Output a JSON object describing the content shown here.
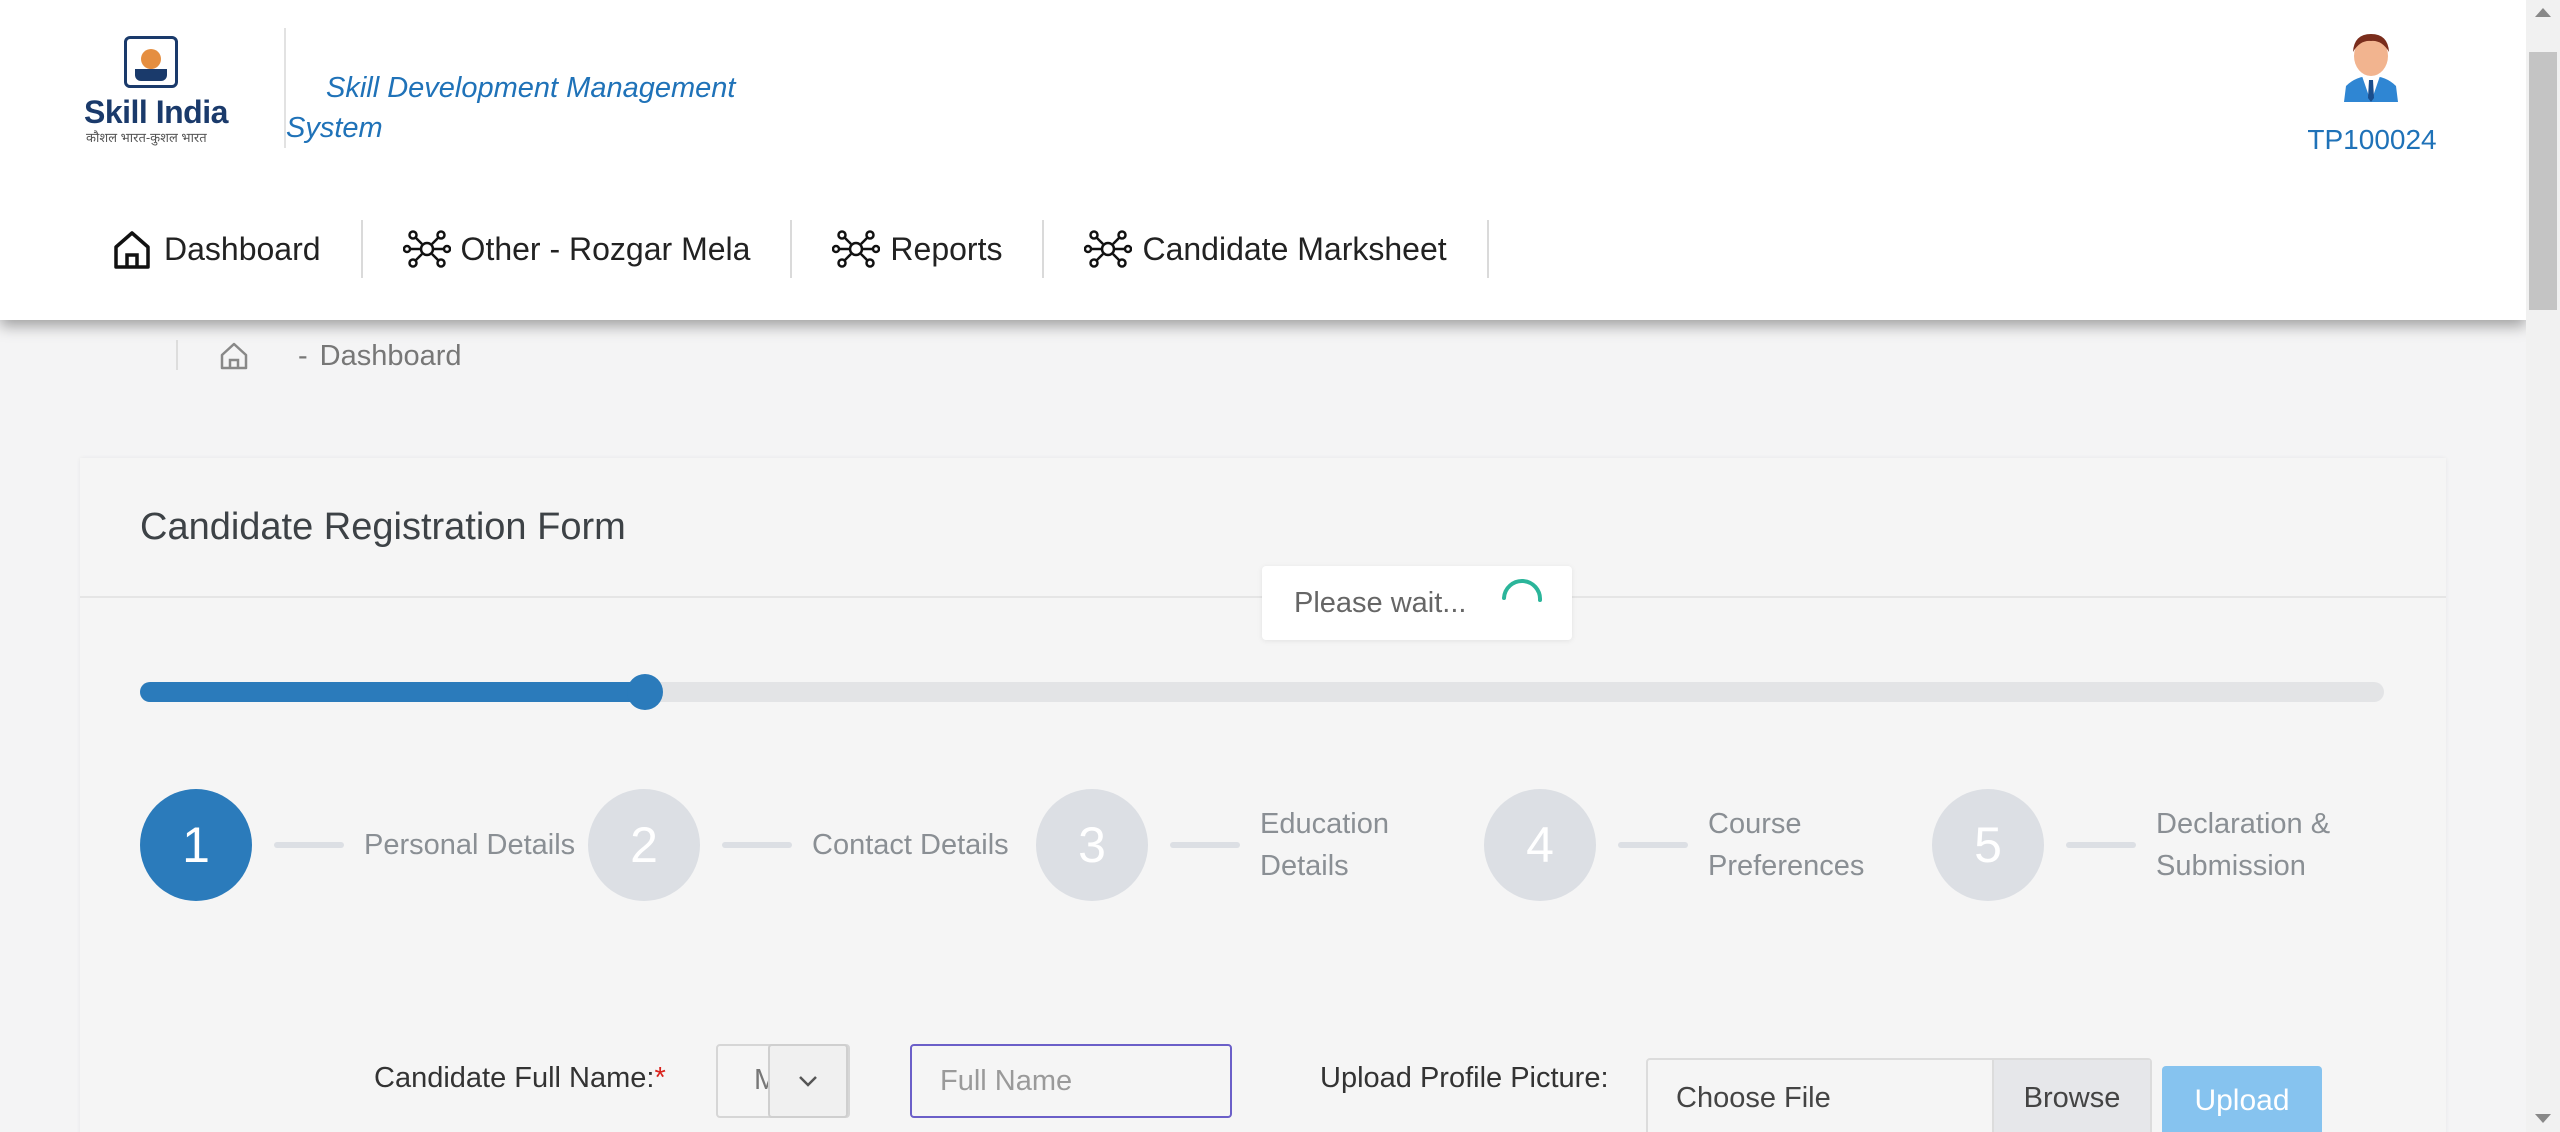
{
  "header": {
    "logo": {
      "name": "Skill India",
      "tagline": "कौशल भारत-कुशल भारत"
    },
    "system_title": "Skill Development Management System",
    "user": {
      "id": "TP100024",
      "avatar": "user-avatar"
    }
  },
  "nav": {
    "items": [
      {
        "label": "Dashboard",
        "icon": "home-icon"
      },
      {
        "label": "Other - Rozgar Mela",
        "icon": "network-icon"
      },
      {
        "label": "Reports",
        "icon": "network-icon"
      },
      {
        "label": "Candidate Marksheet",
        "icon": "network-icon"
      }
    ]
  },
  "breadcrumb": {
    "separator": "-",
    "current": "Dashboard"
  },
  "form": {
    "title": "Candidate Registration Form",
    "progress_fraction": 0.225,
    "steps": [
      {
        "number": "1",
        "label_lines": [
          "Personal Details"
        ],
        "active": true
      },
      {
        "number": "2",
        "label_lines": [
          "Contact Details"
        ],
        "active": false
      },
      {
        "number": "3",
        "label_lines": [
          "Education",
          "Details"
        ],
        "active": false
      },
      {
        "number": "4",
        "label_lines": [
          "Course",
          "Preferences"
        ],
        "active": false
      },
      {
        "number": "5",
        "label_lines": [
          "Declaration &",
          "Submission"
        ],
        "active": false
      }
    ],
    "full_name_label": "Candidate Full Name:",
    "required_mark": "*",
    "salutation_value": "M",
    "full_name_placeholder": "Full Name",
    "upload_label": "Upload Profile Picture:",
    "file_placeholder": "Choose File",
    "browse_label": "Browse",
    "upload_button": "Upload"
  },
  "loading": {
    "message": "Please wait..."
  },
  "colors": {
    "primary": "#2b7bbb",
    "accent_text": "#1f72b8",
    "required": "#d9221c",
    "upload_disabled": "#86c3ef"
  }
}
